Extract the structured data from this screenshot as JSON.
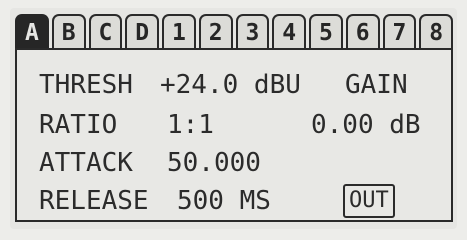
{
  "tabs": [
    {
      "label": "A",
      "active": true
    },
    {
      "label": "B",
      "active": false
    },
    {
      "label": "C",
      "active": false
    },
    {
      "label": "D",
      "active": false
    },
    {
      "label": "1",
      "active": false
    },
    {
      "label": "2",
      "active": false
    },
    {
      "label": "3",
      "active": false
    },
    {
      "label": "4",
      "active": false
    },
    {
      "label": "5",
      "active": false
    },
    {
      "label": "6",
      "active": false
    },
    {
      "label": "7",
      "active": false
    },
    {
      "label": "8",
      "active": false
    }
  ],
  "params": {
    "thresh_label": "THRESH",
    "thresh_value": "+24.0 dBU",
    "gain_label": "GAIN",
    "ratio_label": "RATIO",
    "ratio_value": "1:1",
    "gain_value": "0.00 dB",
    "attack_label": "ATTACK",
    "attack_value": "50.000",
    "release_label": "RELEASE",
    "release_value": "500 MS"
  },
  "out_button": "OUT",
  "colors": {
    "lcd_background": "#e6e6e3",
    "lcd_foreground": "#2b2b2b"
  }
}
